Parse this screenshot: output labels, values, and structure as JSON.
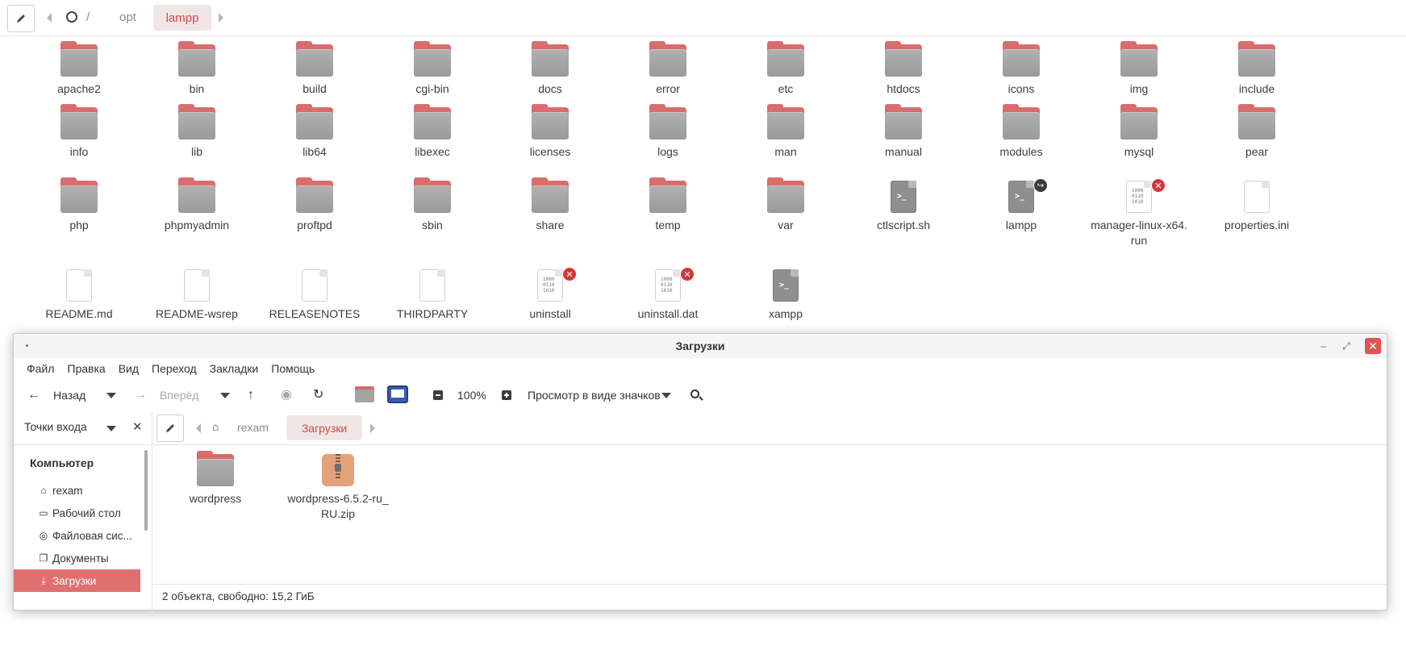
{
  "background": {
    "path": [
      "/",
      "opt"
    ],
    "current": "lampp",
    "items": [
      {
        "name": "apache2",
        "type": "folder"
      },
      {
        "name": "bin",
        "type": "folder"
      },
      {
        "name": "build",
        "type": "folder"
      },
      {
        "name": "cgi-bin",
        "type": "folder"
      },
      {
        "name": "docs",
        "type": "folder"
      },
      {
        "name": "error",
        "type": "folder"
      },
      {
        "name": "etc",
        "type": "folder"
      },
      {
        "name": "htdocs",
        "type": "folder"
      },
      {
        "name": "icons",
        "type": "folder"
      },
      {
        "name": "img",
        "type": "folder"
      },
      {
        "name": "include",
        "type": "folder"
      },
      {
        "name": "info",
        "type": "folder"
      },
      {
        "name": "lib",
        "type": "folder"
      },
      {
        "name": "lib64",
        "type": "folder"
      },
      {
        "name": "libexec",
        "type": "folder"
      },
      {
        "name": "licenses",
        "type": "folder"
      },
      {
        "name": "logs",
        "type": "folder"
      },
      {
        "name": "man",
        "type": "folder"
      },
      {
        "name": "manual",
        "type": "folder"
      },
      {
        "name": "modules",
        "type": "folder"
      },
      {
        "name": "mysql",
        "type": "folder"
      },
      {
        "name": "pear",
        "type": "folder"
      },
      {
        "name": "php",
        "type": "folder"
      },
      {
        "name": "phpmyadmin",
        "type": "folder"
      },
      {
        "name": "proftpd",
        "type": "folder"
      },
      {
        "name": "sbin",
        "type": "folder"
      },
      {
        "name": "share",
        "type": "folder"
      },
      {
        "name": "temp",
        "type": "folder"
      },
      {
        "name": "var",
        "type": "folder"
      },
      {
        "name": "ctlscript.sh",
        "type": "script"
      },
      {
        "name": "lampp",
        "type": "script",
        "badge": "link"
      },
      {
        "name": "manager-linux-x64.\nrun",
        "type": "binary",
        "badge": "x"
      },
      {
        "name": "properties.ini",
        "type": "doc"
      },
      {
        "name": "README.md",
        "type": "doc"
      },
      {
        "name": "README-wsrep",
        "type": "doc"
      },
      {
        "name": "RELEASENOTES",
        "type": "doc"
      },
      {
        "name": "THIRDPARTY",
        "type": "doc"
      },
      {
        "name": "uninstall",
        "type": "binary",
        "badge": "x"
      },
      {
        "name": "uninstall.dat",
        "type": "binary",
        "badge": "x"
      },
      {
        "name": "xampp",
        "type": "script"
      }
    ]
  },
  "window": {
    "title": "Загрузки",
    "menu": [
      "Файл",
      "Правка",
      "Вид",
      "Переход",
      "Закладки",
      "Помощь"
    ],
    "toolbar": {
      "back": "Назад",
      "forward": "Вперёд",
      "zoom": "100%",
      "view": "Просмотр в виде значков"
    },
    "sidebar_header": "Точки входа",
    "path": [
      "rexam"
    ],
    "current": "Загрузки",
    "places_title": "Компьютер",
    "places": [
      {
        "label": "rexam",
        "icon": "home-icon"
      },
      {
        "label": "Рабочий стол",
        "icon": "desktop-icon"
      },
      {
        "label": "Файловая сис...",
        "icon": "filesystem-icon"
      },
      {
        "label": "Документы",
        "icon": "documents-icon"
      },
      {
        "label": "Загрузки",
        "icon": "download-icon",
        "active": true
      }
    ],
    "files": [
      {
        "name": "wordpress",
        "type": "folder"
      },
      {
        "name": "wordpress-6.5.2-ru_\nRU.zip",
        "type": "zip"
      }
    ],
    "status": "2 объекта, свободно: 15,2 ГиБ"
  },
  "colors": {
    "accent": "#e07070",
    "active_text": "#d24a4a",
    "folder_tab": "#d96c6c",
    "folder_body": "#a3a3a3",
    "error_badge": "#d33838"
  }
}
